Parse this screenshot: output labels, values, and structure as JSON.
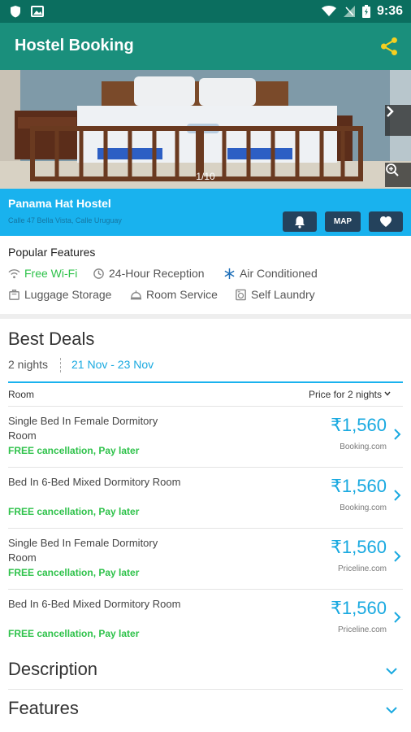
{
  "status_bar": {
    "time": "9:36"
  },
  "app_bar": {
    "title": "Hostel Booking"
  },
  "gallery": {
    "counter": "1/10"
  },
  "hotel": {
    "name": "Panama Hat Hostel",
    "address": "Calle 47 Bella Vista, Calle Uruguay",
    "map_label": "MAP"
  },
  "popular_features": {
    "title": "Popular Features",
    "items": [
      {
        "label": "Free Wi-Fi",
        "icon": "wifi-icon",
        "highlight": true
      },
      {
        "label": "24-Hour Reception",
        "icon": "clock-icon",
        "highlight": false
      },
      {
        "label": "Air Conditioned",
        "icon": "snowflake-icon",
        "highlight": false
      },
      {
        "label": "Luggage Storage",
        "icon": "luggage-icon",
        "highlight": false
      },
      {
        "label": "Room Service",
        "icon": "bell-icon",
        "highlight": false
      },
      {
        "label": "Self Laundry",
        "icon": "washer-icon",
        "highlight": false
      }
    ]
  },
  "deals": {
    "title": "Best Deals",
    "nights": "2 nights",
    "dates": "21 Nov - 23 Nov",
    "col_room": "Room",
    "col_price": "Price for 2 nights",
    "rows": [
      {
        "room": "Single Bed In Female Dormitory Room",
        "cancellation": "FREE cancellation, Pay later",
        "price": "₹1,560",
        "site": "Booking.com"
      },
      {
        "room": "Bed In 6-Bed Mixed Dormitory Room",
        "cancellation": "FREE cancellation, Pay later",
        "price": "₹1,560",
        "site": "Booking.com"
      },
      {
        "room": "Single Bed In Female Dormitory Room",
        "cancellation": "FREE cancellation, Pay later",
        "price": "₹1,560",
        "site": "Priceline.com"
      },
      {
        "room": "Bed In 6-Bed Mixed Dormitory Room",
        "cancellation": "FREE cancellation, Pay later",
        "price": "₹1,560",
        "site": "Priceline.com"
      }
    ]
  },
  "sections": {
    "description": "Description",
    "features": "Features"
  },
  "colors": {
    "status_bar": "#0b6e5f",
    "app_bar": "#1a8f7c",
    "info_bar": "#19b2ee",
    "price": "#19a9e0",
    "free": "#2ec24a",
    "share": "#f5d020"
  }
}
